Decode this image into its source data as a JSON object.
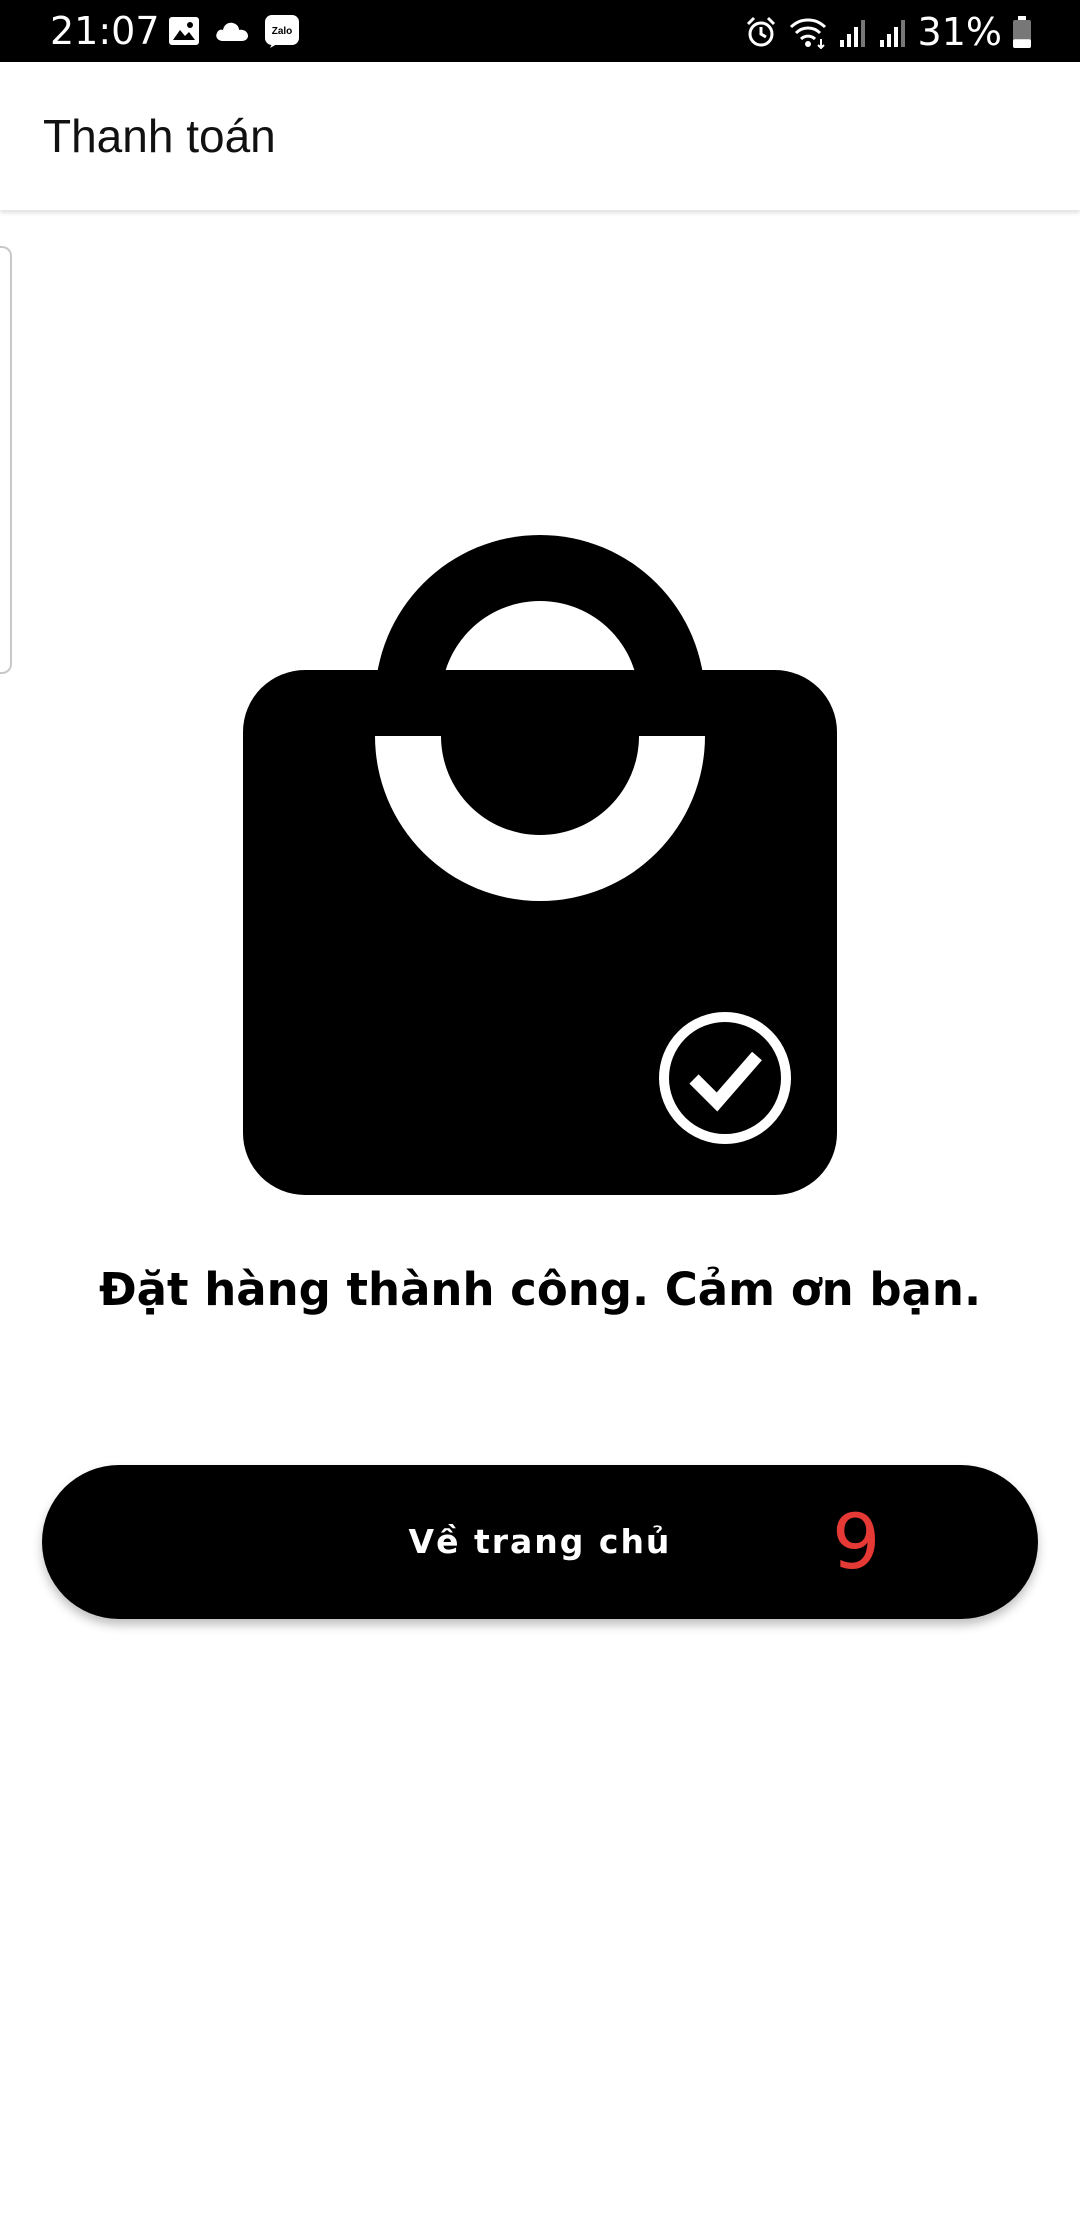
{
  "status_bar": {
    "time": "21:07",
    "battery_percent": "31%",
    "left_icons": [
      "gallery-icon",
      "cloud-icon",
      "zalo-icon"
    ],
    "zalo_label": "Zalo",
    "right_icons": [
      "alarm-icon",
      "wifi-icon",
      "signal-icon",
      "signal-icon",
      "battery-icon"
    ],
    "battery_level": 0.31
  },
  "app_bar": {
    "title": "Thanh toán"
  },
  "hero": {
    "icon": "shopping-bag-check-icon"
  },
  "main": {
    "message": "Đặt hàng thành công. Cảm ơn bạn."
  },
  "home_button": {
    "label": "Về trang chủ",
    "countdown": "9",
    "countdown_color": "#e53935"
  },
  "colors": {
    "primary": "#000000",
    "background": "#ffffff",
    "accent": "#e53935"
  }
}
